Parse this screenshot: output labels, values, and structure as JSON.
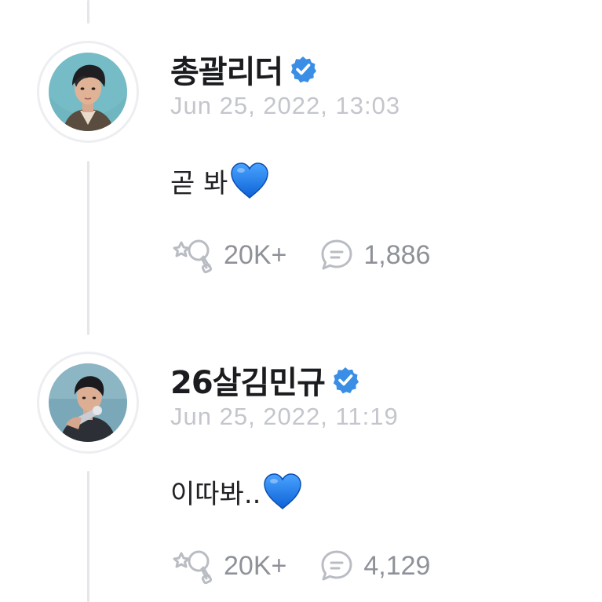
{
  "posts": [
    {
      "author": "총괄리더",
      "verified": true,
      "timestamp": "Jun 25, 2022, 13:03",
      "text": "곧 봐",
      "emoji": "blue-heart",
      "likes": "20K+",
      "comments": "1,886"
    },
    {
      "author": "26살김민규",
      "verified": true,
      "timestamp": "Jun 25, 2022, 11:19",
      "text": "이따봐..",
      "emoji": "blue-heart",
      "likes": "20K+",
      "comments": "4,129"
    }
  ],
  "icons": {
    "verified": "verified-badge-icon",
    "heart": "blue-heart-icon",
    "like": "lightstick-like-icon",
    "comment": "comment-bubble-icon"
  },
  "colors": {
    "verified_blue": "#3a8ee6",
    "heart_blue": "#1a73e8",
    "meta_gray": "#c3c6cc",
    "count_gray": "#8e9298",
    "thread_line": "#e4e6ea"
  }
}
